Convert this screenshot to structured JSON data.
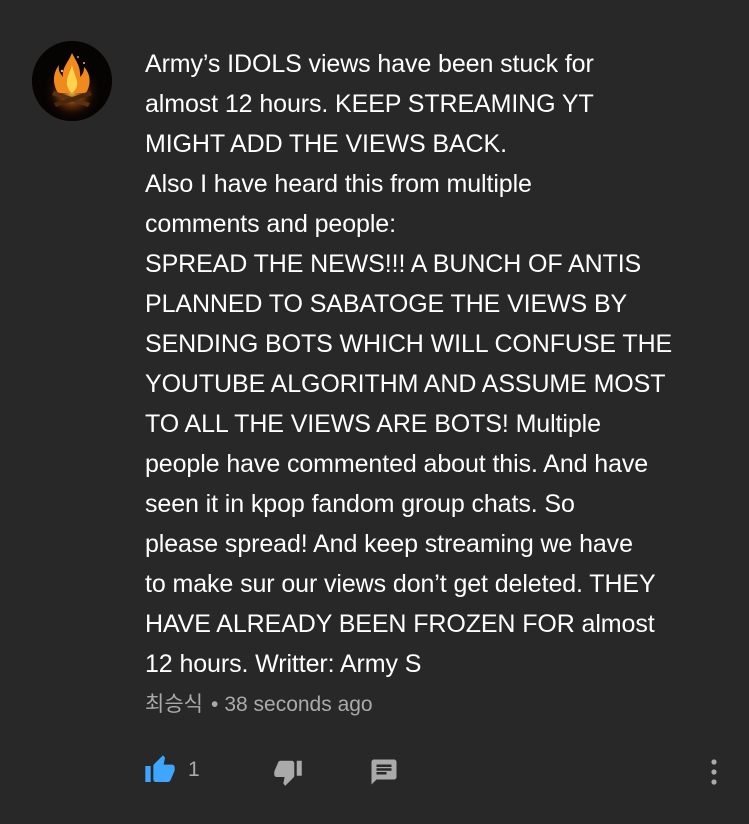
{
  "comment": {
    "avatar_icon": "campfire-avatar",
    "body_lines": [
      "Army’s IDOLS views have been stuck for",
      "almost 12 hours. KEEP STREAMING YT",
      "MIGHT ADD THE VIEWS BACK.",
      "Also I have heard this from multiple",
      "comments and people:",
      "SPREAD THE NEWS!!! A BUNCH OF ANTIS",
      "PLANNED TO SABATOGE THE VIEWS BY",
      "SENDING BOTS WHICH WILL CONFUSE THE",
      "YOUTUBE ALGORITHM AND ASSUME MOST",
      "TO ALL THE VIEWS ARE BOTS! Multiple",
      "people have commented about this. And have",
      "seen it in kpop fandom group chats. So",
      "please spread! And keep streaming we have",
      "to make sur our views don’t get deleted. THEY",
      "HAVE ALREADY BEEN FROZEN FOR almost",
      "12 hours. Writter: Army S"
    ],
    "author": "최승식",
    "separator": "•",
    "timestamp": "38 seconds ago",
    "like_count": "1",
    "colors": {
      "background": "#282828",
      "text": "#ffffff",
      "meta": "#aaaaaa",
      "like_active": "#3ea6ff",
      "icon": "#aaaaaa"
    },
    "icons": {
      "like": "thumbs-up-icon",
      "dislike": "thumbs-down-icon",
      "reply": "reply-icon",
      "more": "more-vert-icon"
    }
  }
}
